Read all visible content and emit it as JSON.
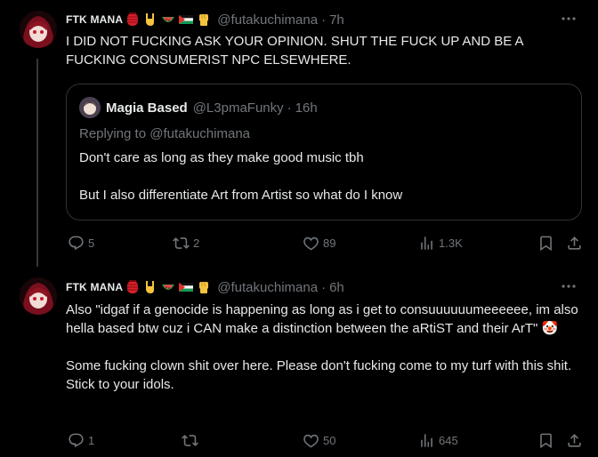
{
  "tweets": [
    {
      "author": {
        "name": "FTK MANA",
        "handle": "@futakuchimana",
        "time": "7h"
      },
      "text": "I DID NOT FUCKING ASK YOUR OPINION. SHUT THE FUCK UP AND BE A FUCKING CONSUMERIST NPC ELSEWHERE.",
      "quote": {
        "name": "Magia Based",
        "handle": "@L3pmaFunky",
        "time": "16h",
        "replying_to": "Replying to @futakuchimana",
        "text": "Don't care as long as they make good music tbh\n\nBut I also differentiate Art from Artist so what do I know"
      },
      "stats": {
        "replies": "5",
        "reposts": "2",
        "likes": "89",
        "views": "1.3K"
      }
    },
    {
      "author": {
        "name": "FTK MANA",
        "handle": "@futakuchimana",
        "time": "6h"
      },
      "text": "Also \"idgaf if a genocide is happening as long as i get to consuuuuuumeeeeee, im also hella based btw cuz i CAN make a distinction between the aRtiST and their ArT\" 🤡\n\nSome fucking clown shit over here. Please don't fucking come to my turf with this shit. Stick to your idols.",
      "stats": {
        "replies": "1",
        "reposts": "",
        "likes": "50",
        "views": "645"
      }
    }
  ],
  "icons": [
    "more-icon",
    "reply-icon",
    "repost-icon",
    "like-icon",
    "views-icon",
    "bookmark-icon",
    "share-icon"
  ],
  "colors": {
    "background": "#000000",
    "text": "#e7e9ea",
    "muted": "#71767b",
    "border": "#2f3336"
  }
}
